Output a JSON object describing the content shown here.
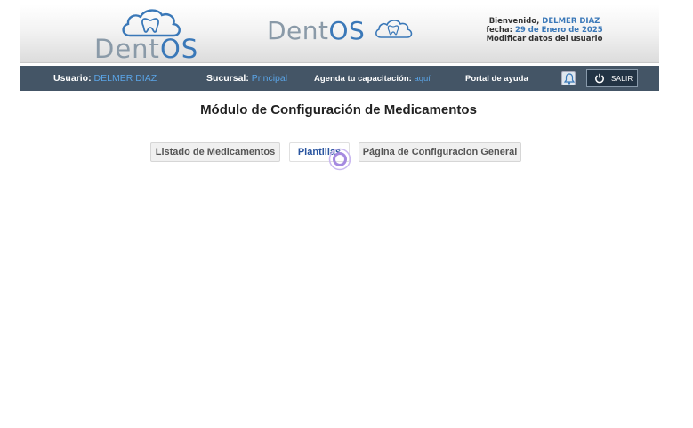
{
  "header": {
    "brand_left": {
      "part1": "Dent",
      "part2": "OS"
    },
    "brand_center": {
      "part1": "Dent",
      "part2": "OS"
    },
    "welcome": {
      "greeting_label": "Bienvenido,",
      "user_name": "DELMER DIAZ",
      "date_label": "fecha:",
      "date_value": "29 de Enero de 2025",
      "edit_link": "Modificar datos del usuario"
    },
    "icons": {
      "logo_cloud": "cloud-tooth-icon"
    }
  },
  "navbar": {
    "user_label": "Usuario:",
    "user_value": "DELMER DIAZ",
    "branch_label": "Sucursal:",
    "branch_value": "Principal",
    "training_label": "Agenda tu capacitación:",
    "training_link": "aquí",
    "help_label": "Portal de ayuda",
    "logout_label": "SALIR",
    "icons": {
      "bell": "bell-icon",
      "power": "power-icon"
    }
  },
  "main": {
    "title": "Módulo de Configuración de Medicamentos",
    "tabs": [
      {
        "label": "Listado de Medicamentos",
        "active": false
      },
      {
        "label": "Plantillas",
        "active": true
      },
      {
        "label": "Página de Configuracion General",
        "active": false
      }
    ]
  },
  "colors": {
    "accent": "#3a78b8",
    "navbar_bg": "#445566",
    "navbar_highlight": "#5aa4e6",
    "cursor": "#a58ae0"
  }
}
